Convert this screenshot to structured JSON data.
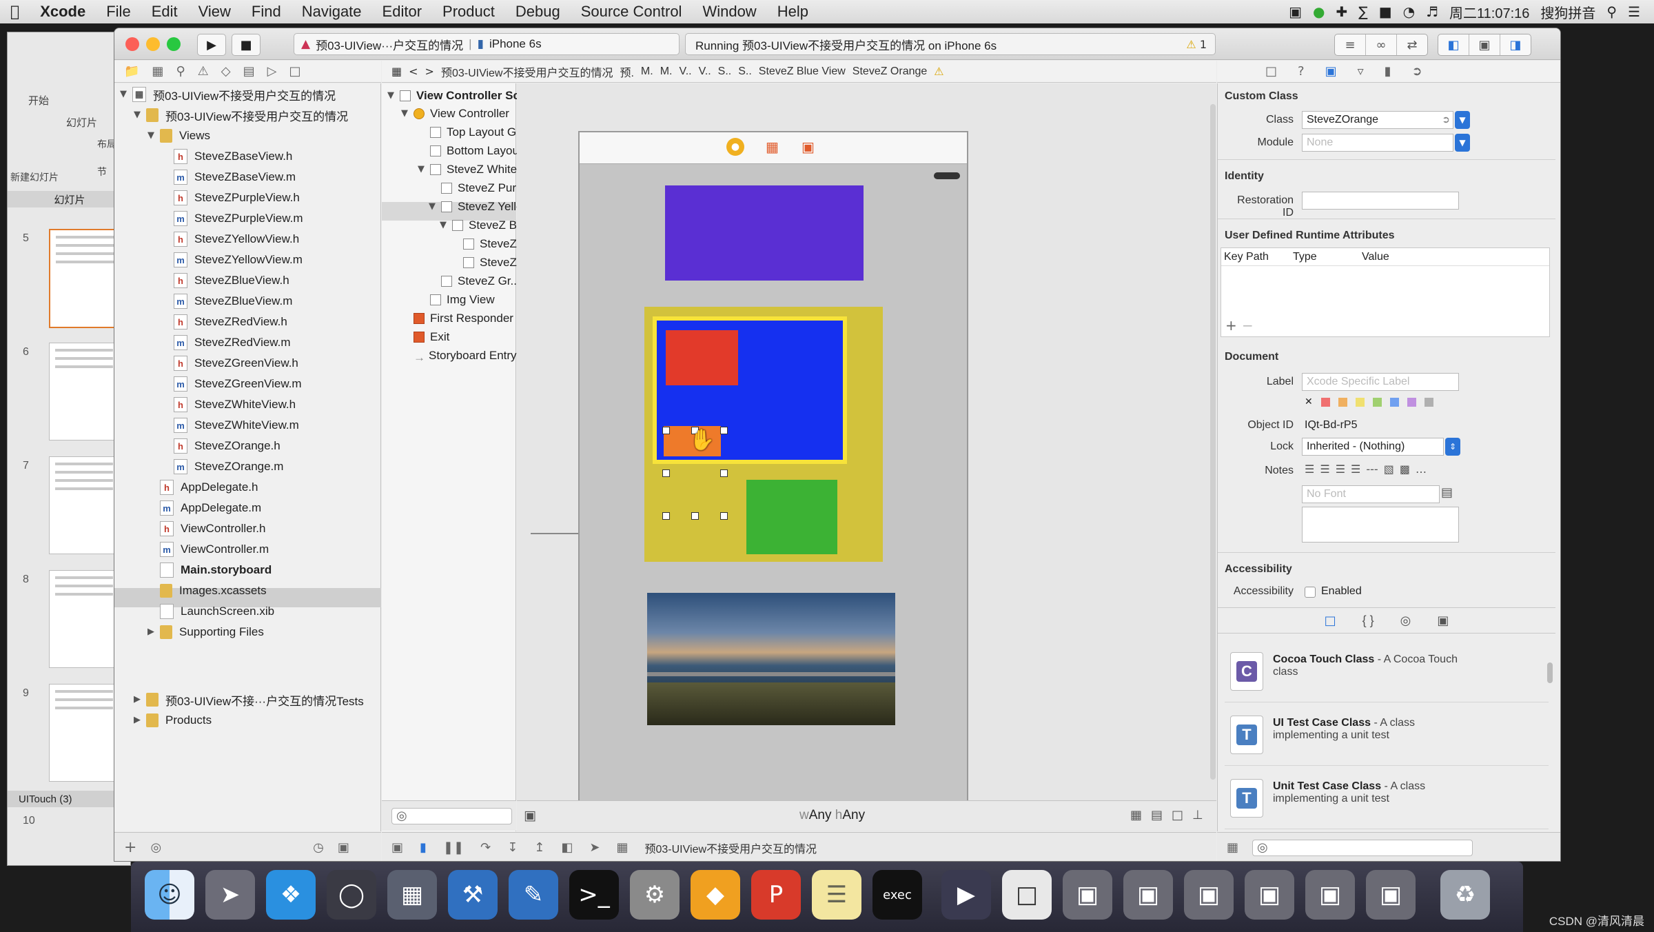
{
  "menubar": {
    "app": "Xcode",
    "items": [
      "File",
      "Edit",
      "View",
      "Find",
      "Navigate",
      "Editor",
      "Product",
      "Debug",
      "Source Control",
      "Window",
      "Help"
    ],
    "clock": "周二11:07:16",
    "input_method": "搜狗拼音"
  },
  "keynote": {
    "toolbar_labels": [
      "开始",
      "幻灯片",
      "新建幻灯片",
      "布局",
      "节"
    ],
    "panel_label": "幻灯片",
    "slide_numbers": [
      "5",
      "6",
      "7",
      "8",
      "9",
      "10"
    ],
    "bottom_label": "UITouch (3)"
  },
  "toolbar": {
    "scheme_name": "预03-UIView···户交互的情况",
    "device": "iPhone 6s",
    "status_text": "Running 预03-UIView不接受用户交互的情况 on iPhone 6s",
    "warning_count": "1"
  },
  "jumpbar": [
    "预03-UIView不接受用户交互的情况",
    "预.",
    "M.",
    "M.",
    "V..",
    "V..",
    "S..",
    "S..",
    "SteveZ Blue View",
    "SteveZ Orange"
  ],
  "navigator": {
    "project": "预03-UIView不接受用户交互的情况",
    "group": "预03-UIView不接受用户交互的情况",
    "views_group": "Views",
    "view_files": [
      {
        "badge": "h",
        "name": "SteveZBaseView.h"
      },
      {
        "badge": "m",
        "name": "SteveZBaseView.m"
      },
      {
        "badge": "h",
        "name": "SteveZPurpleView.h"
      },
      {
        "badge": "m",
        "name": "SteveZPurpleView.m"
      },
      {
        "badge": "h",
        "name": "SteveZYellowView.h"
      },
      {
        "badge": "m",
        "name": "SteveZYellowView.m"
      },
      {
        "badge": "h",
        "name": "SteveZBlueView.h"
      },
      {
        "badge": "m",
        "name": "SteveZBlueView.m"
      },
      {
        "badge": "h",
        "name": "SteveZRedView.h"
      },
      {
        "badge": "m",
        "name": "SteveZRedView.m"
      },
      {
        "badge": "h",
        "name": "SteveZGreenView.h"
      },
      {
        "badge": "m",
        "name": "SteveZGreenView.m"
      },
      {
        "badge": "h",
        "name": "SteveZWhiteView.h"
      },
      {
        "badge": "m",
        "name": "SteveZWhiteView.m"
      },
      {
        "badge": "h",
        "name": "SteveZOrange.h"
      },
      {
        "badge": "m",
        "name": "SteveZOrange.m"
      }
    ],
    "group_files": [
      {
        "badge": "h",
        "name": "AppDelegate.h"
      },
      {
        "badge": "m",
        "name": "AppDelegate.m"
      },
      {
        "badge": "h",
        "name": "ViewController.h"
      },
      {
        "badge": "m",
        "name": "ViewController.m"
      },
      {
        "badge": "",
        "name": "Main.storyboard"
      },
      {
        "badge": "",
        "name": "Images.xcassets"
      },
      {
        "badge": "",
        "name": "LaunchScreen.xib"
      },
      {
        "badge": "",
        "name": "Supporting Files"
      }
    ],
    "tests_group": "预03-UIView不接···户交互的情况Tests",
    "products_group": "Products"
  },
  "outline": {
    "scene": "View Controller Scene",
    "items": [
      "View Controller",
      "Top Layout Guide",
      "Bottom Layout...",
      "SteveZ White View",
      "SteveZ Purpl...",
      "SteveZ Yello...",
      "SteveZ Bl...",
      "SteveZ...",
      "SteveZ...",
      "SteveZ Gr...",
      "Img View",
      "First Responder",
      "Exit",
      "Storyboard Entry Point"
    ]
  },
  "canvas": {
    "size_w": "Any",
    "size_h": "Any",
    "bottom_path": "预03-UIView不接受用户交互的情况"
  },
  "inspector": {
    "custom_class_title": "Custom Class",
    "class_label": "Class",
    "class_value": "SteveZOrange",
    "module_label": "Module",
    "module_placeholder": "None",
    "identity_title": "Identity",
    "restoration_label": "Restoration ID",
    "udra_title": "User Defined Runtime Attributes",
    "col_keypath": "Key Path",
    "col_type": "Type",
    "col_value": "Value",
    "document_title": "Document",
    "label_label": "Label",
    "label_placeholder": "Xcode Specific Label",
    "objectid_label": "Object ID",
    "objectid_value": "IQt-Bd-rP5",
    "lock_label": "Lock",
    "lock_value": "Inherited - (Nothing)",
    "notes_label": "Notes",
    "font_placeholder": "No Font",
    "accessibility_title": "Accessibility",
    "accessibility_label": "Accessibility",
    "enabled_label": "Enabled",
    "library": [
      {
        "title": "Cocoa Touch Class",
        "desc": "- A Cocoa Touch class",
        "icon": "C",
        "color": "#6b5aa8"
      },
      {
        "title": "UI Test Case Class",
        "desc": "- A class implementing a unit test",
        "icon": "T",
        "color": "#4a7fc1"
      },
      {
        "title": "Unit Test Case Class",
        "desc": "- A class implementing a unit test",
        "icon": "T",
        "color": "#4a7fc1"
      }
    ]
  },
  "colors": {
    "purple": "#5a2fd3",
    "yellow": "#d2c23c",
    "blue": "#1530f0",
    "red": "#e23a2a",
    "orange": "#ee7a2a",
    "green": "#3cb234"
  },
  "watermark": "CSDN @清风清晨"
}
